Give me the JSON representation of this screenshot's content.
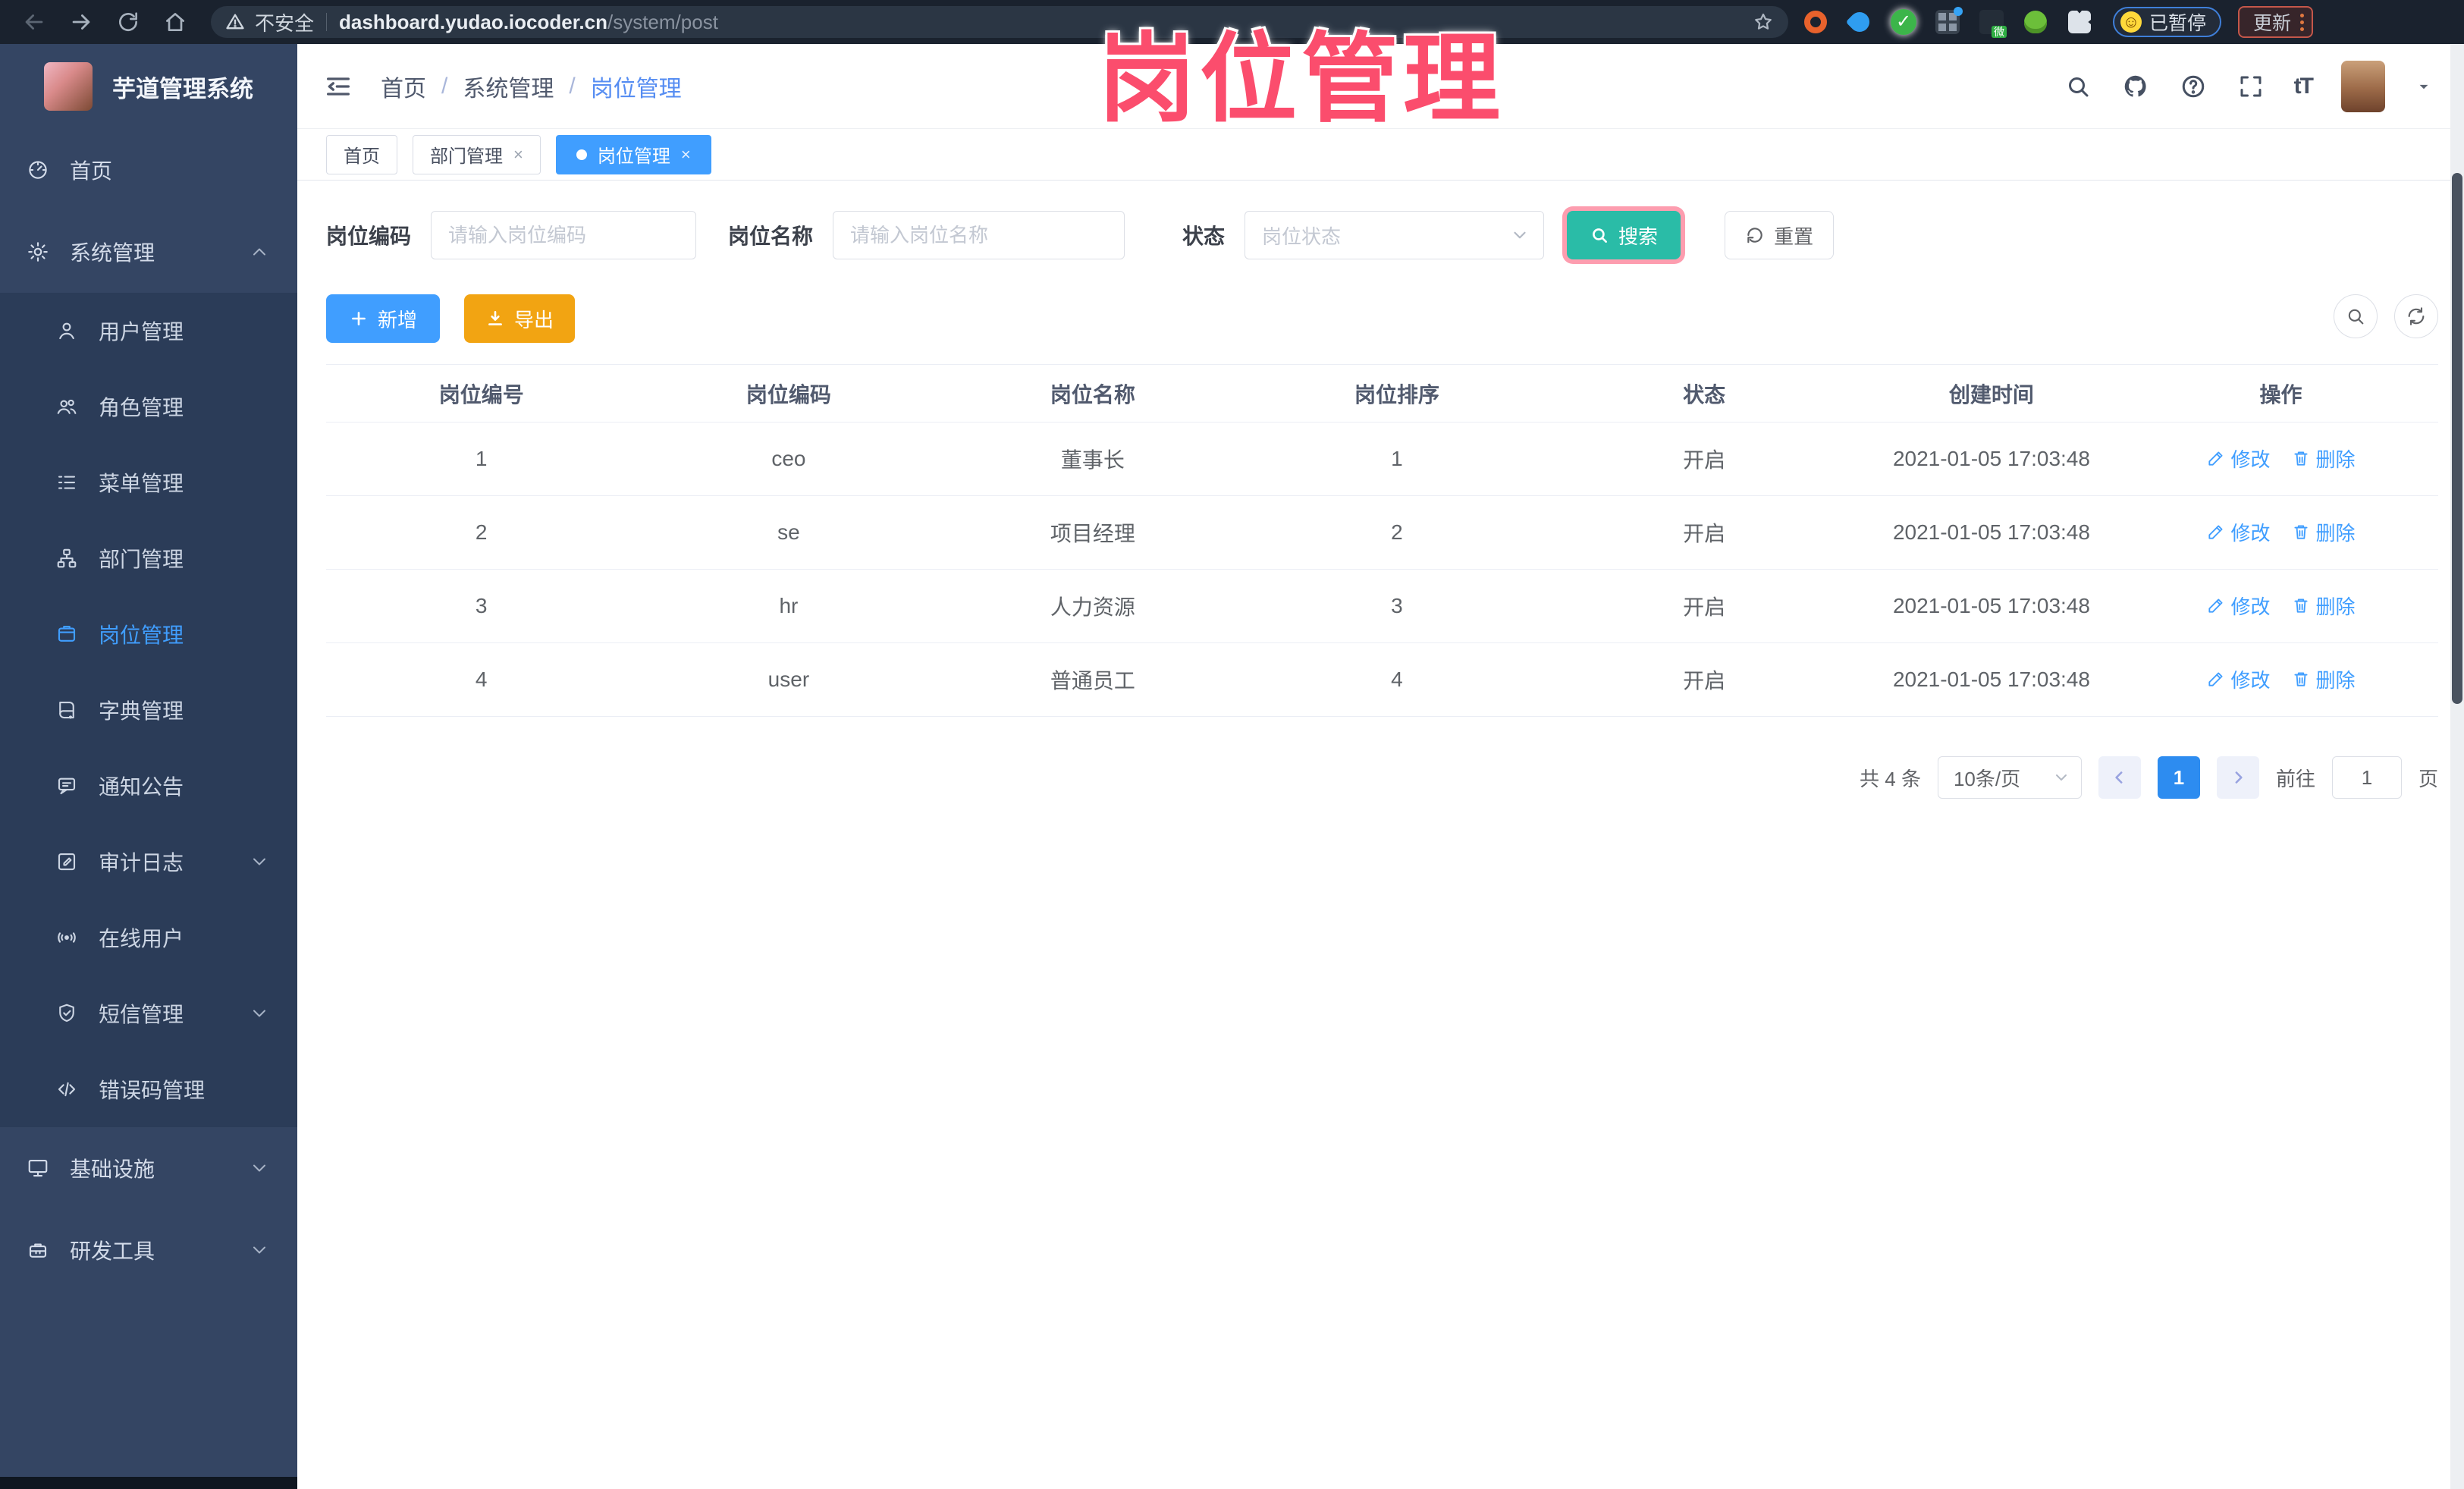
{
  "colors": {
    "primary": "#409eff",
    "search_button": "#2abca7",
    "export_button": "#f2a412",
    "annotation_pink": "#fb4d6d",
    "sidebar_bg": "#344563",
    "submenu_bg": "#2b3c58",
    "chrome_bg": "#1a222e"
  },
  "annotation": {
    "watermark": "岗位管理"
  },
  "browser": {
    "security_label": "不安全",
    "url_host": "dashboard.yudao.iocoder.cn",
    "url_path": "/system/post",
    "paused_label": "已暂停",
    "update_label": "更新",
    "nav_icons": [
      "back-icon",
      "forward-icon",
      "reload-icon",
      "home-icon"
    ],
    "extension_icons": [
      "extension-orange-ring-icon",
      "extension-blue-drop-icon",
      "extension-green-check-icon",
      "extension-grid-icon",
      "extension-files-icon",
      "extension-green-bug-icon",
      "extension-puzzle-icon"
    ]
  },
  "sidebar": {
    "logo_title": "芋道管理系统",
    "menu": [
      {
        "key": "home",
        "label": "首页",
        "icon": "dashboard-icon",
        "level": 1
      },
      {
        "key": "system",
        "label": "系统管理",
        "icon": "gear-icon",
        "level": 1,
        "chevron": "up"
      },
      {
        "key": "user",
        "label": "用户管理",
        "icon": "user-icon",
        "level": 2
      },
      {
        "key": "role",
        "label": "角色管理",
        "icon": "users-icon",
        "level": 2
      },
      {
        "key": "menu",
        "label": "菜单管理",
        "icon": "menu-list-icon",
        "level": 2
      },
      {
        "key": "dept",
        "label": "部门管理",
        "icon": "org-tree-icon",
        "level": 2
      },
      {
        "key": "post",
        "label": "岗位管理",
        "icon": "post-badge-icon",
        "level": 2,
        "active": true
      },
      {
        "key": "dict",
        "label": "字典管理",
        "icon": "book-icon",
        "level": 2
      },
      {
        "key": "notice",
        "label": "通知公告",
        "icon": "notice-bubble-icon",
        "level": 2
      },
      {
        "key": "audit",
        "label": "审计日志",
        "icon": "log-pen-icon",
        "level": 2,
        "chevron": "down"
      },
      {
        "key": "online",
        "label": "在线用户",
        "icon": "online-signal-icon",
        "level": 2
      },
      {
        "key": "sms",
        "label": "短信管理",
        "icon": "shield-icon",
        "level": 2,
        "chevron": "down"
      },
      {
        "key": "errcode",
        "label": "错误码管理",
        "icon": "code-icon",
        "level": 2
      },
      {
        "key": "infra",
        "label": "基础设施",
        "icon": "monitor-icon",
        "level": 1,
        "chevron": "down"
      },
      {
        "key": "devtool",
        "label": "研发工具",
        "icon": "toolbox-icon",
        "level": 1,
        "chevron": "down"
      }
    ]
  },
  "header": {
    "breadcrumb": [
      "首页",
      "系统管理",
      "岗位管理"
    ],
    "right_icons": [
      "search-icon",
      "github-icon",
      "help-icon",
      "fullscreen-icon",
      "font-size-icon",
      "avatar",
      "caret-down-icon"
    ],
    "font_size_glyph": "tT"
  },
  "tabs": [
    {
      "label": "首页",
      "closable": false,
      "active": false
    },
    {
      "label": "部门管理",
      "closable": true,
      "active": false
    },
    {
      "label": "岗位管理",
      "closable": true,
      "active": true
    }
  ],
  "filters": {
    "code_label": "岗位编码",
    "code_placeholder": "请输入岗位编码",
    "name_label": "岗位名称",
    "name_placeholder": "请输入岗位名称",
    "status_label": "状态",
    "status_placeholder": "岗位状态",
    "search_label": "搜索",
    "reset_label": "重置"
  },
  "toolbar": {
    "add_label": "新增",
    "export_label": "导出",
    "corner_icons": [
      "magnifier-toggle-icon",
      "refresh-icon"
    ]
  },
  "table": {
    "columns": [
      "岗位编号",
      "岗位编码",
      "岗位名称",
      "岗位排序",
      "状态",
      "创建时间",
      "操作"
    ],
    "rows": [
      [
        "1",
        "ceo",
        "董事长",
        "1",
        "开启",
        "2021-01-05 17:03:48"
      ],
      [
        "2",
        "se",
        "项目经理",
        "2",
        "开启",
        "2021-01-05 17:03:48"
      ],
      [
        "3",
        "hr",
        "人力资源",
        "3",
        "开启",
        "2021-01-05 17:03:48"
      ],
      [
        "4",
        "user",
        "普通员工",
        "4",
        "开启",
        "2021-01-05 17:03:48"
      ]
    ],
    "edit_label": "修改",
    "delete_label": "删除"
  },
  "pagination": {
    "total_label": "共 4 条",
    "page_size": "10条/页",
    "current_page": "1",
    "goto_label": "前往",
    "goto_value": "1",
    "page_unit": "页"
  }
}
